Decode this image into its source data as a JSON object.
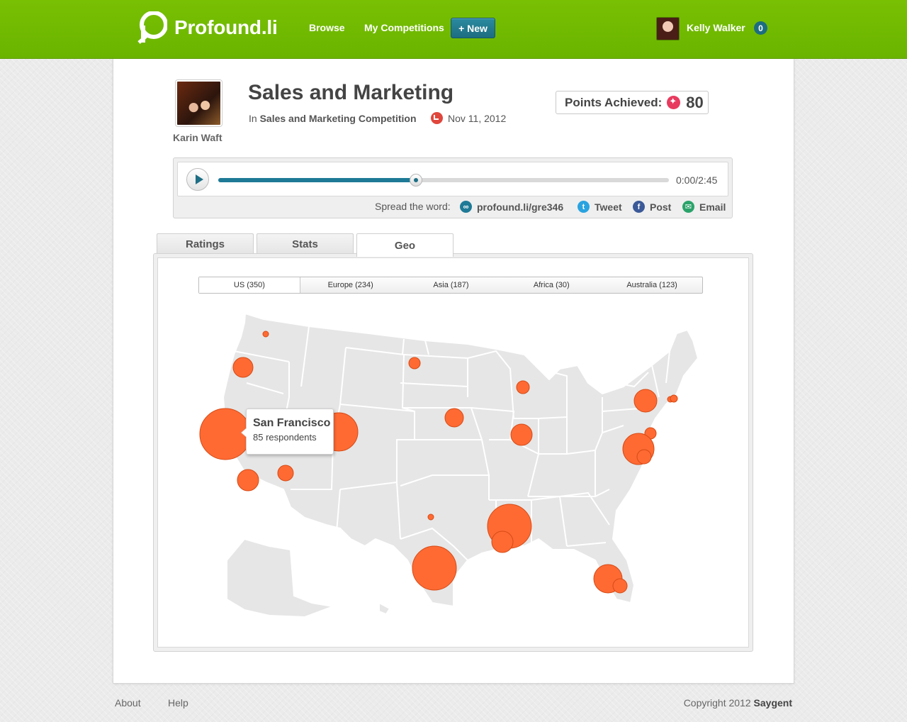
{
  "app": {
    "name": "Profound.li"
  },
  "nav": {
    "browse": "Browse",
    "my_competitions": "My Competitions",
    "new_button": "+ New"
  },
  "user": {
    "name": "Kelly Walker",
    "notifications": "0"
  },
  "recording": {
    "author": "Karin Waft",
    "title": "Sales and Marketing",
    "in_prefix": "In",
    "competition": "Sales and Marketing Competition",
    "date": "Nov 11, 2012",
    "points_label": "Points Achieved:",
    "points_value": "80"
  },
  "player": {
    "time": "0:00/2:45",
    "progress": 0.438,
    "spread_label": "Spread the word:",
    "short_link": "profound.li/gre346",
    "tweet": "Tweet",
    "post": "Post",
    "email": "Email"
  },
  "tabs": [
    {
      "label": "Ratings"
    },
    {
      "label": "Stats"
    },
    {
      "label": "Geo"
    }
  ],
  "regions": [
    {
      "label": "US (350)"
    },
    {
      "label": "Europe (234)"
    },
    {
      "label": "Asia (187)"
    },
    {
      "label": "Africa (30)"
    },
    {
      "label": "Australia (123)"
    }
  ],
  "tooltip": {
    "city": "San Francisco",
    "count": "85 respondents"
  },
  "colors": {
    "brand_green": "#6fb800",
    "accent_teal": "#1e6f85",
    "bubble": "#ff6a33",
    "points_pink": "#e83a5e"
  },
  "footer": {
    "about": "About",
    "help": "Help",
    "copyright_prefix": "Copyright 2012",
    "company": "Saygent"
  }
}
